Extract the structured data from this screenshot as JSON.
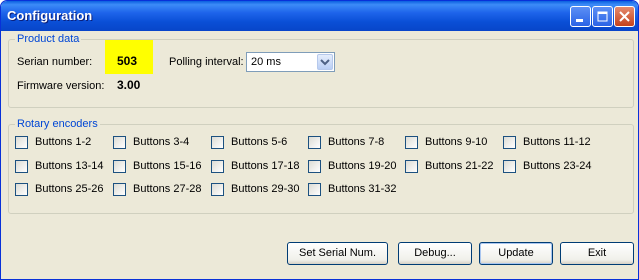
{
  "window": {
    "title": "Configuration"
  },
  "product": {
    "legend": "Product data",
    "serial_label": "Serian number:",
    "serial_value": "503",
    "firmware_label": "Firmware version:",
    "firmware_value": "3.00",
    "polling_label": "Polling interval:",
    "polling_value": "20 ms"
  },
  "rotary": {
    "legend": "Rotary encoders",
    "items": [
      {
        "label": "Buttons 1-2",
        "checked": false
      },
      {
        "label": "Buttons 3-4",
        "checked": false
      },
      {
        "label": "Buttons 5-6",
        "checked": false
      },
      {
        "label": "Buttons 7-8",
        "checked": false
      },
      {
        "label": "Buttons 9-10",
        "checked": false
      },
      {
        "label": "Buttons 11-12",
        "checked": false
      },
      {
        "label": "Buttons 13-14",
        "checked": false
      },
      {
        "label": "Buttons 15-16",
        "checked": false
      },
      {
        "label": "Buttons 17-18",
        "checked": false
      },
      {
        "label": "Buttons 19-20",
        "checked": false
      },
      {
        "label": "Buttons 21-22",
        "checked": false
      },
      {
        "label": "Buttons 23-24",
        "checked": false
      },
      {
        "label": "Buttons 25-26",
        "checked": false
      },
      {
        "label": "Buttons 27-28",
        "checked": false
      },
      {
        "label": "Buttons 29-30",
        "checked": false
      },
      {
        "label": "Buttons 31-32",
        "checked": false
      }
    ]
  },
  "buttons": {
    "set_serial": "Set Serial Num.",
    "debug": "Debug...",
    "update": "Update",
    "exit": "Exit"
  },
  "colors": {
    "highlight": "#ffff00",
    "titlebar": "#0a4fd6",
    "legend_text": "#0046d5"
  }
}
